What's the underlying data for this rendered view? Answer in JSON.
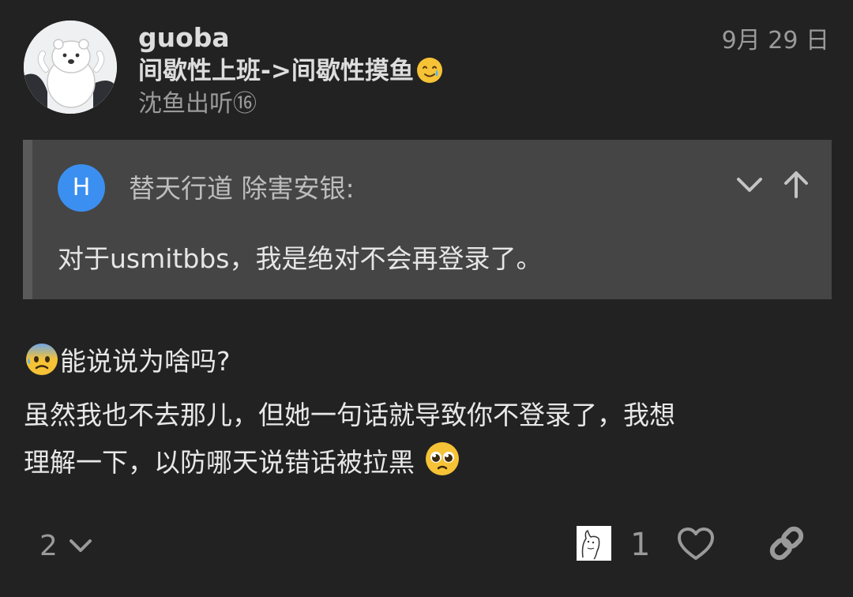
{
  "post": {
    "username": "guoba",
    "user_title": "间歇性上班->间歇性摸鱼",
    "user_group": "沈鱼出听⑯",
    "date": "9月 29 日",
    "quote": {
      "avatar_letter": "H",
      "author": "替天行道 除害安银:",
      "text": "对于usmitbbs，我是绝对不会再登录了。"
    },
    "body": {
      "line1": "能说说为啥吗?",
      "line2": "虽然我也不去那儿，但她一句话就导致你不登录了，我想",
      "line3": "理解一下，以防哪天说错话被拉黑 "
    },
    "footer": {
      "reply_count": "2",
      "like_count": "1"
    }
  },
  "colors": {
    "background": "#222222",
    "quote_background": "#454545",
    "quote_avatar": "#3b8ff0",
    "muted_text": "#9a9a9a"
  },
  "icons": {
    "title_emoji": "smiling-face-with-tear-icon",
    "body_emoji_start": "anxious-face-with-sweat-icon",
    "body_emoji_end": "pleading-face-icon",
    "quote_collapse": "chevron-down-icon",
    "quote_jump": "arrow-up-icon",
    "replies_expand": "chevron-down-icon",
    "like": "heart-icon",
    "share": "link-icon"
  }
}
